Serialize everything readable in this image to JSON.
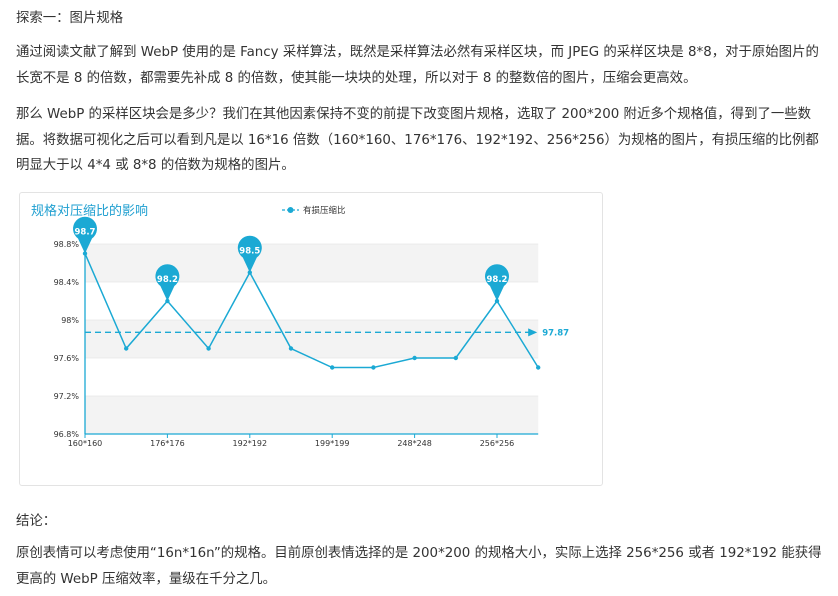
{
  "article": {
    "heading": "探索一：图片规格",
    "para1": "通过阅读文献了解到 WebP 使用的是 Fancy 采样算法，既然是采样算法必然有采样区块，而 JPEG 的采样区块是 8*8，对于原始图片的长宽不是 8 的倍数，都需要先补成 8 的倍数，使其能一块块的处理，所以对于 8 的整数倍的图片，压缩会更高效。",
    "para2": "那么 WebP 的采样区块会是多少？我们在其他因素保持不变的前提下改变图片规格，选取了 200*200 附近多个规格值，得到了一些数据。将数据可视化之后可以看到凡是以 16*16 倍数（160*160、176*176、192*192、256*256）为规格的图片，有损压缩的比例都明显大于以 4*4 或 8*8 的倍数为规格的图片。",
    "conclusion_label": "结论：",
    "para3": "原创表情可以考虑使用“16n*16n”的规格。目前原创表情选择的是 200*200 的规格大小，实际上选择 256*256 或者 192*192 能获得更高的 WebP 压缩效率，量级在千分之几。"
  },
  "colors": {
    "series": "#1ba9d4",
    "title": "#1f9fd0",
    "band": "#f3f3f3",
    "grid": "#e6e6e6"
  },
  "chart_data": {
    "type": "line",
    "title": "规格对压缩比的影响",
    "legend_position": "top-center",
    "x_tick_labels": [
      "160*160",
      "176*176",
      "192*192",
      "199*199",
      "248*248",
      "256*256"
    ],
    "ylim": [
      96.8,
      98.8
    ],
    "y_tick_labels": [
      "96.8%",
      "97.2%",
      "97.6%",
      "98%",
      "98.4%",
      "98.8%"
    ],
    "grid_bands": true,
    "series": [
      {
        "name": "有损压缩比",
        "values": [
          98.7,
          97.7,
          98.2,
          97.7,
          98.5,
          97.7,
          97.5,
          97.5,
          97.6,
          97.6,
          98.2,
          97.5
        ]
      }
    ],
    "markers": [
      {
        "label": "98.7",
        "index": 0
      },
      {
        "label": "98.2",
        "index": 2
      },
      {
        "label": "98.5",
        "index": 4
      },
      {
        "label": "98.2",
        "index": 10
      }
    ],
    "average": {
      "value": 97.87,
      "label": "97.87"
    }
  }
}
